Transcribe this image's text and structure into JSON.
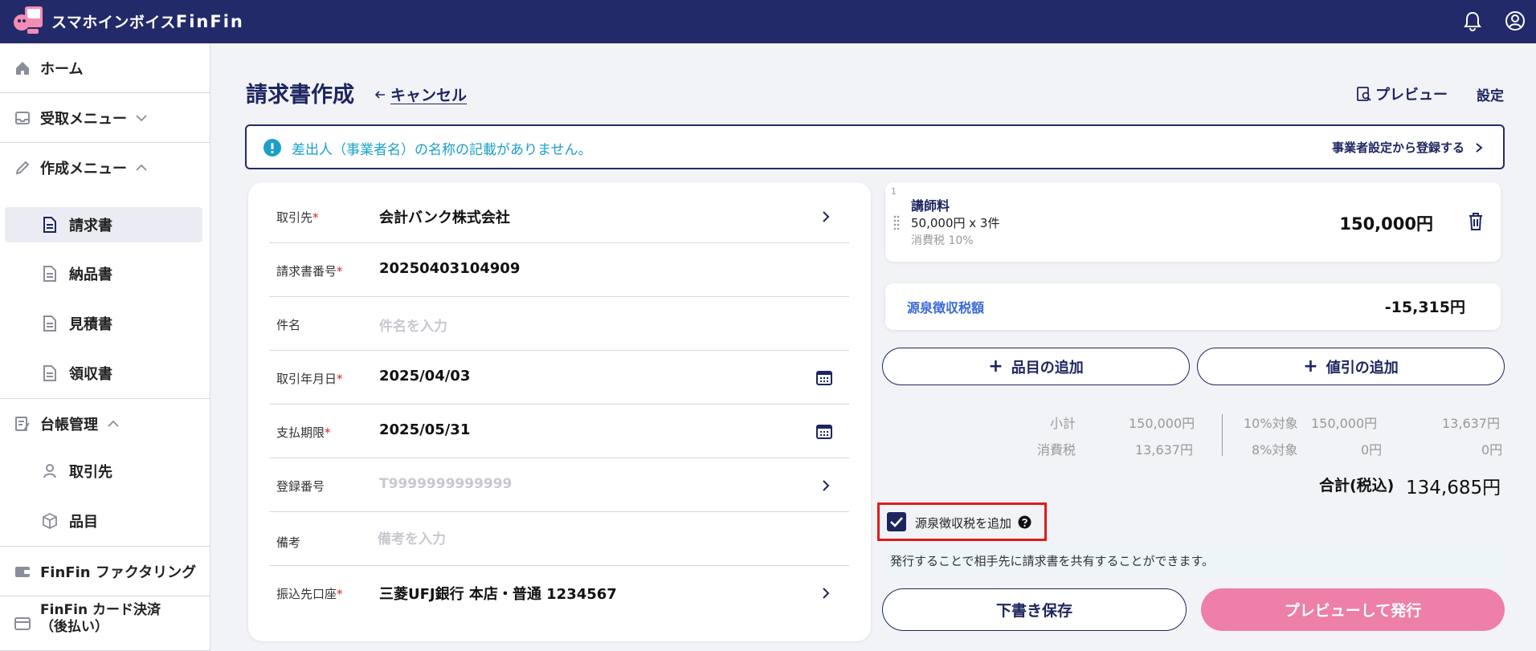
{
  "app": {
    "logo_text": "スマホインボイス",
    "logo_brand": "FinFin"
  },
  "header_icons": [
    "bell-icon",
    "account-icon"
  ],
  "sidebar": {
    "home": "ホーム",
    "receive_menu": "受取メニュー",
    "create_menu": "作成メニュー",
    "create_items": [
      "請求書",
      "納品書",
      "見積書",
      "領収書"
    ],
    "ledger": "台帳管理",
    "ledger_items": [
      "取引先",
      "品目"
    ],
    "factoring": "FinFin ファクタリング",
    "card_payment_line1": "FinFin カード決済",
    "card_payment_line2": "（後払い）"
  },
  "page": {
    "title": "請求書作成",
    "cancel": "キャンセル",
    "preview": "プレビュー",
    "settings": "設定"
  },
  "alert": {
    "message": "差出人（事業者名）の名称の記載がありません。",
    "action": "事業者設定から登録する"
  },
  "form": {
    "client_label": "取引先",
    "client_value": "会計バンク株式会社",
    "invoice_no_label": "請求書番号",
    "invoice_no_value": "20250403104909",
    "subject_label": "件名",
    "subject_placeholder": "件名を入力",
    "date_label": "取引年月日",
    "date_value": "2025/04/03",
    "due_label": "支払期限",
    "due_value": "2025/05/31",
    "reg_no_label": "登録番号",
    "reg_no_placeholder": "T9999999999999",
    "note_label": "備考",
    "note_placeholder": "備考を入力",
    "bank_label": "振込先口座",
    "bank_value": "三菱UFJ銀行 本店・普通 1234567",
    "required_mark": "*"
  },
  "item": {
    "index": "1",
    "name": "講師料",
    "qty": "50,000円 x 3件",
    "tax": "消費税 10%",
    "amount": "150,000円"
  },
  "withholding": {
    "label": "源泉徴収税額",
    "amount": "-15,315円"
  },
  "buttons": {
    "add_item": "品目の追加",
    "add_discount": "値引の追加",
    "draft": "下書き保存",
    "issue": "プレビューして発行"
  },
  "summary": {
    "subtotal_label": "小計",
    "subtotal_value": "150,000円",
    "tax_label": "消費税",
    "tax_value": "13,637円",
    "r10_label": "10%対象",
    "r10_base": "150,000円",
    "r10_tax": "13,637円",
    "r8_label": "8%対象",
    "r8_base": "0円",
    "r8_tax": "0円",
    "total_label": "合計(税込)",
    "total_value": "134,685円"
  },
  "withholding_checkbox": {
    "label": "源泉徴収税を追加",
    "checked": true
  },
  "info": "発行することで相手先に請求書を共有することができます。",
  "colors": {
    "navy": "#232a6a",
    "accent_pink": "#ee7fa8",
    "alert_text": "#1aa0c8",
    "highlight_red": "#e01b1b"
  }
}
